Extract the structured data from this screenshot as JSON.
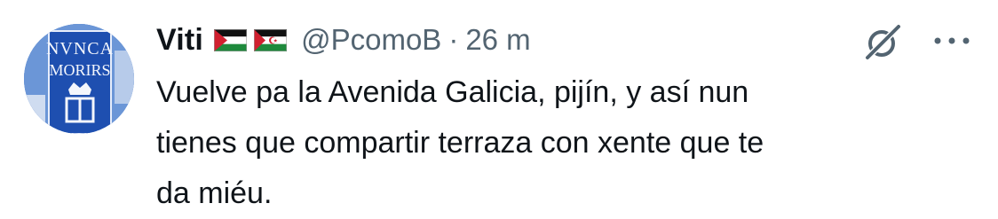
{
  "tweet": {
    "author": {
      "display_name": "Viti",
      "handle": "@PcomoB",
      "avatar_icon": "avatar-image",
      "flags": [
        {
          "name": "palestine-flag-icon"
        },
        {
          "name": "western-sahara-flag-icon"
        }
      ]
    },
    "separator": "·",
    "time": "26 m",
    "text": "Vuelve pa la Avenida Galicia, pijín, y así nun\ntienes que compartir terraza con xente que te\nda miéu.",
    "icons": {
      "grok": "grok-icon",
      "more": "more-options-icon"
    },
    "colors": {
      "text": "#0f1419",
      "secondary": "#536471"
    }
  }
}
